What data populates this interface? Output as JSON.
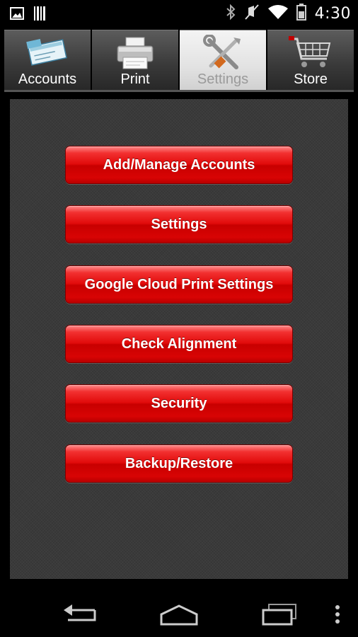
{
  "status_bar": {
    "time": "4:30",
    "icons": [
      "image-icon",
      "barcode-icon",
      "bluetooth-icon",
      "mute-icon",
      "wifi-icon",
      "battery-icon"
    ]
  },
  "tabs": [
    {
      "label": "Accounts",
      "icon": "check-icon",
      "active": false
    },
    {
      "label": "Print",
      "icon": "printer-icon",
      "active": false
    },
    {
      "label": "Settings",
      "icon": "tools-icon",
      "active": true
    },
    {
      "label": "Store",
      "icon": "cart-icon",
      "active": false
    }
  ],
  "menu": {
    "buttons": [
      {
        "label": "Add/Manage Accounts"
      },
      {
        "label": "Settings"
      },
      {
        "label": "Google Cloud Print Settings"
      },
      {
        "label": "Check Alignment"
      },
      {
        "label": "Security"
      },
      {
        "label": "Backup/Restore"
      }
    ]
  },
  "nav_bar": {
    "icons": [
      "back-icon",
      "home-icon",
      "recent-apps-icon",
      "overflow-menu-icon"
    ]
  },
  "colors": {
    "button_red": "#e10a0a",
    "panel_bg": "#3a3a3a",
    "active_tab_label": "#9a9a9a"
  }
}
